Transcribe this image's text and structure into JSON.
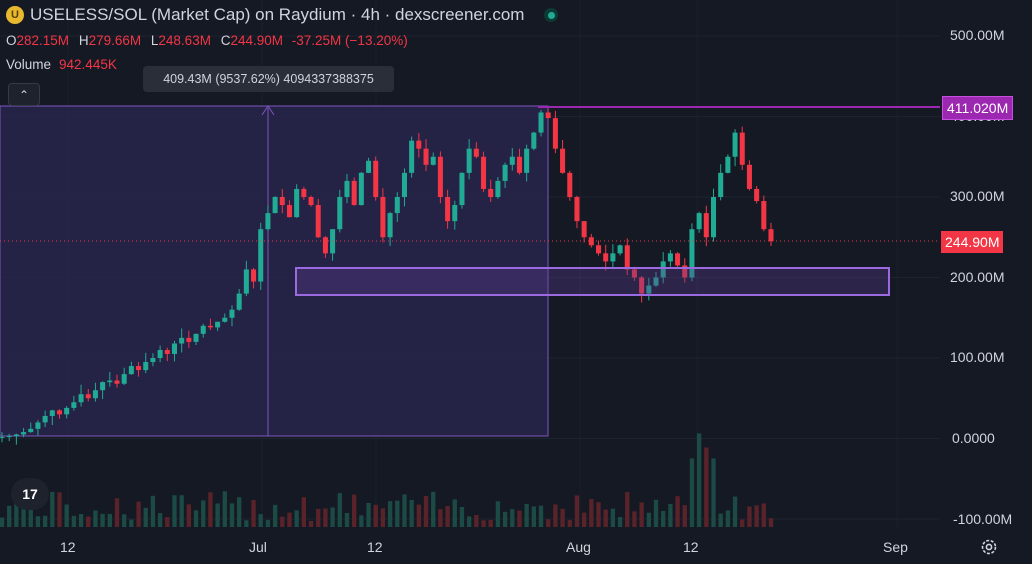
{
  "header": {
    "coin_glyph": "U",
    "title": "USELESS/SOL (Market Cap) on Raydium · 4h · dexscreener.com"
  },
  "ohlc": {
    "o_label": "O",
    "o_value": "282.15M",
    "h_label": "H",
    "h_value": "279.66M",
    "l_label": "L",
    "l_value": "248.63M",
    "c_label": "C",
    "c_value": "244.90M",
    "change": "-37.25M (−13.20%)"
  },
  "volume": {
    "label": "Volume",
    "value": "942.445K"
  },
  "tooltip": {
    "text": "409.43M (9537.62%) 4094337388375"
  },
  "collapse_icon": "chevron-up-icon",
  "axis": {
    "y_ticks": [
      "500.00M",
      "400.00M",
      "300.00M",
      "200.00M",
      "100.00M",
      "0.0000",
      "-100.00M"
    ],
    "x_ticks": [
      "12",
      "Jul",
      "12",
      "Aug",
      "12",
      "Sep"
    ]
  },
  "price_tags": {
    "level": "411.020M",
    "current": "244.90M"
  },
  "colors": {
    "up": "#22ab94",
    "down": "#f23645",
    "drawing": "#9c27b0",
    "background": "#151924"
  },
  "logo": {
    "text": "17"
  },
  "chart_data": {
    "type": "candlestick",
    "ylim": [
      -100,
      500
    ],
    "y_unit": "M",
    "current_price": 244.9,
    "horizontal_level": 411.02,
    "zone": [
      180,
      210
    ],
    "series_close": [
      2,
      3,
      5,
      8,
      12,
      20,
      28,
      35,
      30,
      38,
      45,
      55,
      50,
      60,
      70,
      72,
      68,
      80,
      90,
      85,
      95,
      100,
      110,
      105,
      118,
      125,
      120,
      130,
      140,
      138,
      145,
      150,
      160,
      180,
      210,
      195,
      260,
      280,
      300,
      290,
      275,
      310,
      300,
      290,
      250,
      230,
      260,
      300,
      320,
      290,
      330,
      345,
      300,
      250,
      280,
      300,
      330,
      370,
      360,
      340,
      350,
      300,
      270,
      290,
      330,
      360,
      350,
      310,
      300,
      320,
      340,
      350,
      330,
      360,
      380,
      405,
      398,
      360,
      330,
      300,
      270,
      250,
      240,
      230,
      220,
      230,
      240,
      210,
      200,
      180,
      190,
      200,
      220,
      230,
      215,
      200,
      260,
      280,
      250,
      300,
      330,
      350,
      380,
      340,
      310,
      295,
      260,
      245
    ]
  }
}
